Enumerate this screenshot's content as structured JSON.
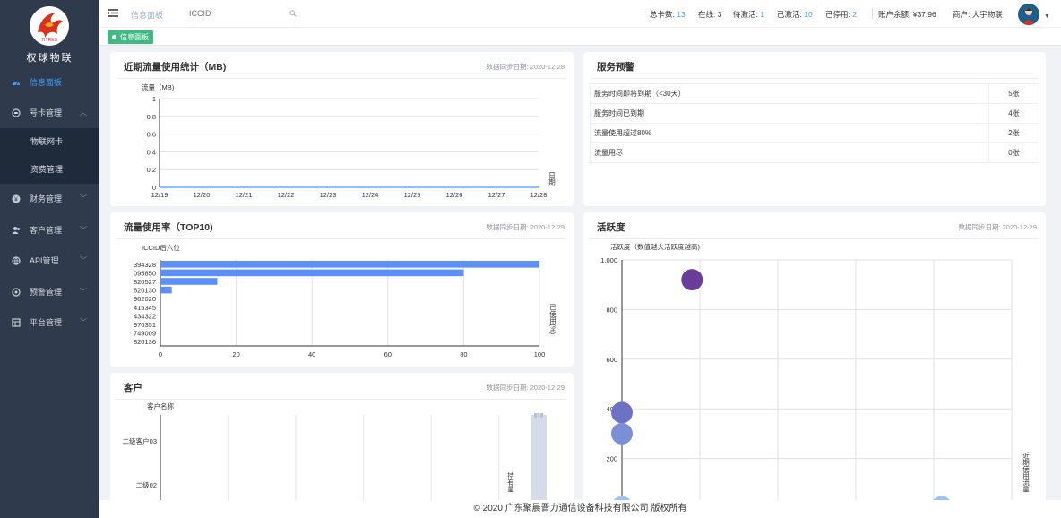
{
  "brand": {
    "name": "权球物联",
    "logo_text": "TITRES"
  },
  "sidebar": {
    "items": [
      {
        "label": "信息面板",
        "icon": "dashboard-icon"
      },
      {
        "label": "号卡管理",
        "icon": "card-icon"
      },
      {
        "label": "物联网卡"
      },
      {
        "label": "资费管理"
      },
      {
        "label": "财务管理",
        "icon": "finance-icon"
      },
      {
        "label": "客户管理",
        "icon": "users-icon"
      },
      {
        "label": "API管理",
        "icon": "api-icon"
      },
      {
        "label": "预警管理",
        "icon": "alert-icon"
      },
      {
        "label": "平台管理",
        "icon": "platform-icon"
      }
    ]
  },
  "header": {
    "breadcrumb": "信息面板",
    "search_placeholder": "ICCID",
    "stats": {
      "total_label": "总卡数:",
      "total": "13",
      "online_label": "在线:",
      "online": "3",
      "pending_label": "待激活:",
      "pending": "1",
      "active_label": "已激活:",
      "active": "10",
      "stopped_label": "已停用:",
      "stopped": "2",
      "balance": "账户余额: ¥37.96",
      "merchant": "商户: 大宇物联"
    }
  },
  "tags": {
    "current": "信息面板"
  },
  "traffic": {
    "title": "近期流量使用统计（MB)",
    "sync": "数据同步日期: 2020-12-28",
    "chart_data": {
      "type": "line",
      "ylabel": "流量（MB)",
      "xlabel": "日期",
      "categories": [
        "12/19",
        "12/20",
        "12/21",
        "12/22",
        "12/23",
        "12/24",
        "12/25",
        "12/26",
        "12/27",
        "12/28"
      ],
      "values": [
        0,
        0,
        0,
        0,
        0,
        0,
        0,
        0,
        0,
        0
      ],
      "ylim": [
        0,
        1
      ],
      "yticks": [
        "0",
        "0.2",
        "0.4",
        "0.6",
        "0.8",
        "1"
      ],
      "color": "#409eff"
    }
  },
  "service_warning": {
    "title": "服务预警",
    "rows": [
      {
        "label": "服务时间即将到期（<30天）",
        "value": "5张"
      },
      {
        "label": "服务时间已到期",
        "value": "4张"
      },
      {
        "label": "流量使用超过80%",
        "value": "2张"
      },
      {
        "label": "流量用尽",
        "value": "0张"
      }
    ]
  },
  "usage_top10": {
    "title": "流量使用率（TOP10)",
    "sync": "数据同步日期: 2020-12-29",
    "chart_data": {
      "type": "bar",
      "ylabel": "ICCID后六位",
      "xlabel": "已使用(%)",
      "categories": [
        "394328",
        "095850",
        "820527",
        "820130",
        "962020",
        "415345",
        "434322",
        "970351",
        "749009",
        "820136"
      ],
      "values": [
        100,
        80,
        15,
        3,
        0,
        0,
        0,
        0,
        0,
        0
      ],
      "xlim": [
        0,
        100
      ],
      "xticks": [
        "0",
        "20",
        "40",
        "60",
        "80",
        "100"
      ],
      "color": "#5b8ff9"
    }
  },
  "activity": {
    "title": "活跃度",
    "sync": "数据同步日期: 2020-12-29",
    "chart_data": {
      "type": "scatter",
      "ylabel": "活跃度（数值越大活跃度越高)",
      "xlabel": "近期使用流量",
      "ylim": [
        0,
        1000
      ],
      "yticks": [
        "200",
        "400",
        "600",
        "800",
        "1,000"
      ],
      "points": [
        {
          "x": 0.18,
          "y": 920,
          "color": "#6a3d9a"
        },
        {
          "x": 0.0,
          "y": 385,
          "color": "#6c72c6"
        },
        {
          "x": 0.0,
          "y": 300,
          "color": "#7b8fd6"
        },
        {
          "x": 0.0,
          "y": 5,
          "color": "#9ec3ee"
        },
        {
          "x": 0.82,
          "y": 5,
          "color": "#9ec3ee"
        }
      ]
    }
  },
  "customers": {
    "title": "客户",
    "sync": "数据同步日期: 2020-12-29",
    "chart_data": {
      "type": "bar",
      "ylabel": "客户名称",
      "xlabel": "持有量",
      "categories": [
        "二级客户03",
        "二级02"
      ],
      "top_label": "11"
    }
  },
  "footer": {
    "copyright": "© 2020 广东聚晨晋力通信设备科技有限公司 版权所有"
  }
}
